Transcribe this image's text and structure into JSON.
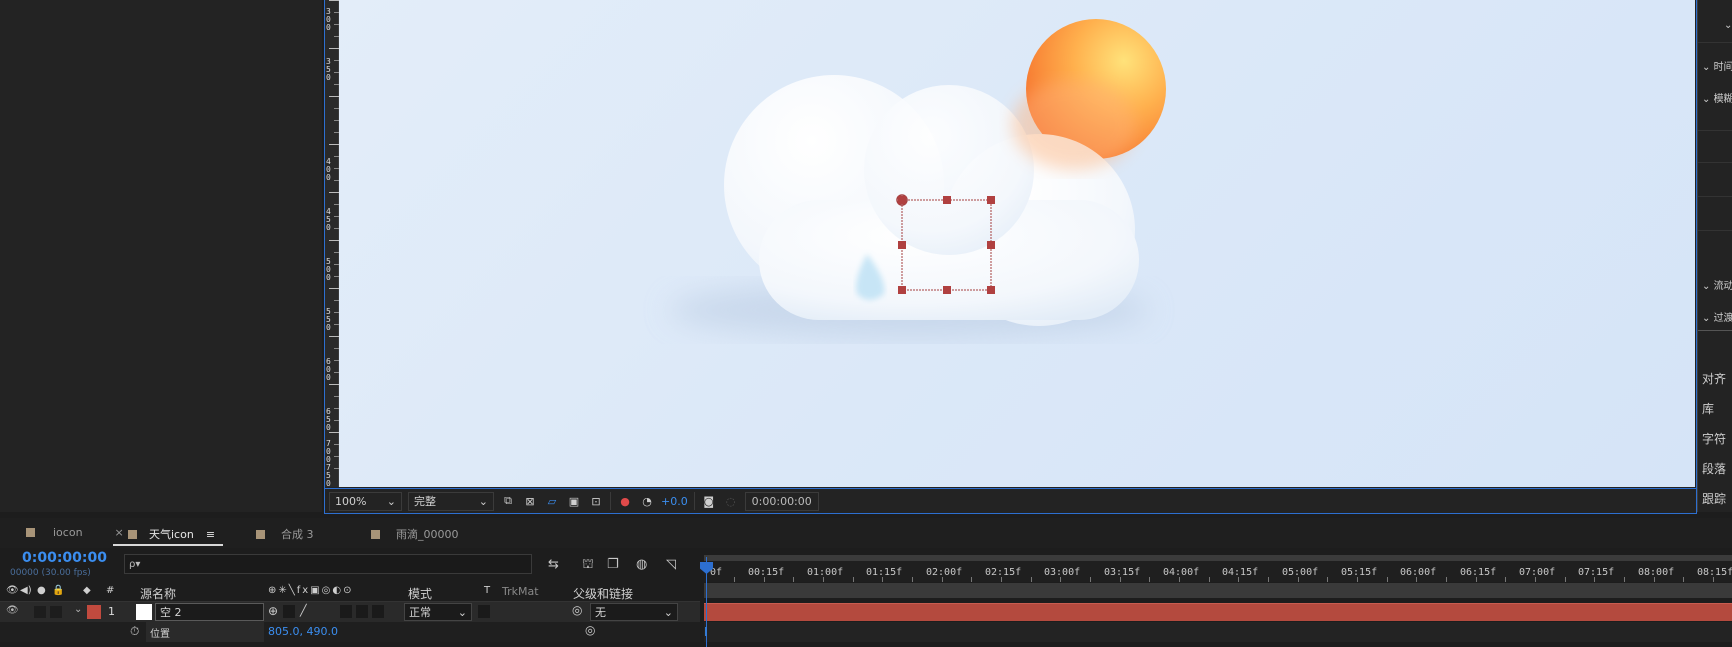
{
  "viewer": {
    "zoom": "100%",
    "quality": "完整",
    "exposure": "+0.0",
    "timecode": "0:00:00:00"
  },
  "ruler_labels": [
    "3",
    "0",
    "0",
    "3",
    "5",
    "0",
    "4",
    "0",
    "0",
    "4",
    "5",
    "0",
    "5",
    "0",
    "0",
    "5",
    "5",
    "0",
    "6",
    "0",
    "0",
    "6",
    "5",
    "0",
    "7",
    "0",
    "0",
    "7",
    "5",
    "0"
  ],
  "right_panel": {
    "items": [
      "时间",
      "模糊",
      "流动",
      "过渡",
      "对齐",
      "库",
      "字符",
      "段落",
      "跟踪"
    ]
  },
  "tabs": [
    {
      "label": "iocon",
      "close": "×"
    },
    {
      "label": "天气icon",
      "menu": "≡"
    },
    {
      "label": "合成 3"
    },
    {
      "label": "雨滴_00000"
    }
  ],
  "timeline": {
    "current_time": "0:00:00:00",
    "fps_label": "00000 (30.00 fps)",
    "search_placeholder": "ρ▾",
    "columns": {
      "number": "#",
      "source_name": "源名称",
      "mode": "模式",
      "t": "T",
      "trkmat": "TrkMat",
      "parent": "父级和链接"
    },
    "layer": {
      "number": "1",
      "name": "空 2",
      "mode": "正常",
      "parent": "无"
    },
    "property": {
      "name": "位置",
      "value": "805.0, 490.0"
    },
    "ruler_labels": [
      "0f",
      "00:15f",
      "01:00f",
      "01:15f",
      "02:00f",
      "02:15f",
      "03:00f",
      "03:15f",
      "04:00f",
      "04:15f",
      "05:00f",
      "05:15f",
      "06:00f",
      "06:15f",
      "07:00f",
      "07:15f",
      "08:00f",
      "08:15f"
    ]
  },
  "colors": {
    "accent_blue": "#2d6fd0",
    "layer_red": "#b44a3e",
    "timecode_blue": "#3b8ef0",
    "sun_orange": "#f58a3c"
  },
  "icons": [
    "eye-icon",
    "audio-icon",
    "solo-icon",
    "lock-icon",
    "label-icon",
    "stopwatch-icon",
    "camera-icon",
    "color-channel-icon",
    "search-icon"
  ]
}
